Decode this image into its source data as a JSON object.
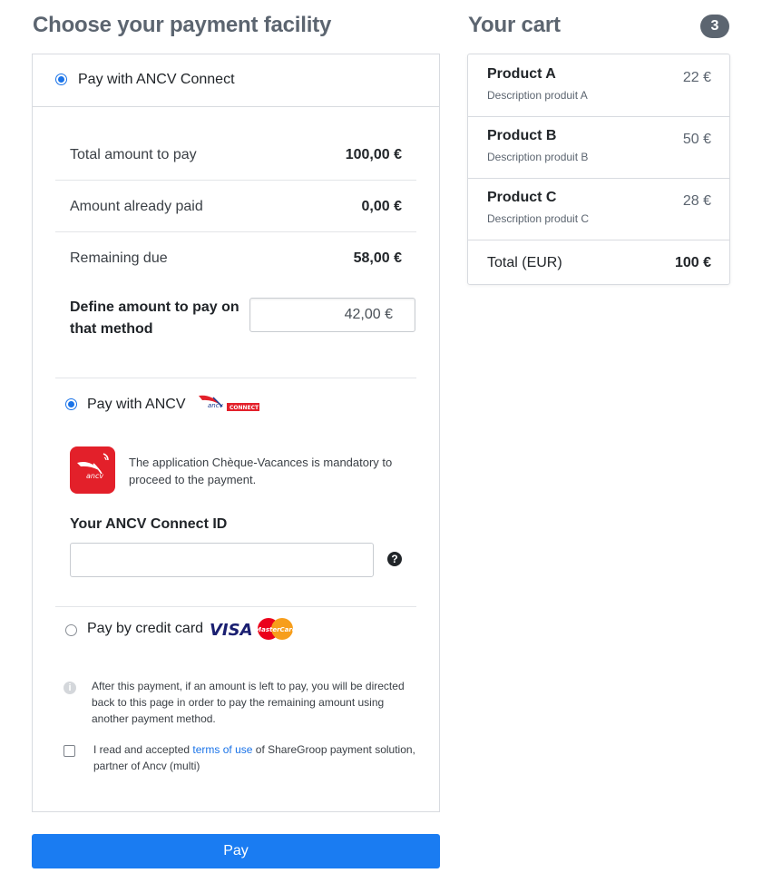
{
  "page": {
    "title": "Choose your payment facility",
    "pay_button": "Pay"
  },
  "ancv_connect": {
    "label": "Pay with ANCV Connect",
    "selected": true,
    "rows": [
      {
        "label": "Total amount to pay",
        "value": "100,00 €"
      },
      {
        "label": "Amount already paid",
        "value": "0,00 €"
      },
      {
        "label": "Remaining due",
        "value": "58,00 €"
      }
    ],
    "define_label": "Define amount to pay on that method",
    "amount_value": "42,00 €"
  },
  "pay_ancv": {
    "label": "Pay with ANCV",
    "selected": true,
    "logo_text": "ancv",
    "logo_badge": "CONNECT",
    "info": "The application Chèque-Vacances is mandatory to proceed to the payment.",
    "id_label": "Your ANCV Connect ID",
    "id_value": "",
    "help_glyph": "?"
  },
  "credit_card": {
    "label": "Pay by credit card",
    "selected": false,
    "visa_text": "VISA",
    "mastercard_text": "MasterCard"
  },
  "note": {
    "text": "After this payment, if an amount is left to pay, you will be directed back to this page in order to pay the remaining amount using another payment method.",
    "icon_glyph": "i"
  },
  "terms": {
    "prefix": "I read and accepted ",
    "link": "terms of use",
    "suffix": " of ShareGroop payment solution, partner of Ancv (multi)",
    "checked": false
  },
  "cart": {
    "title": "Your cart",
    "count": "3",
    "items": [
      {
        "name": "Product A",
        "description": "Description produit A",
        "price": "22 €"
      },
      {
        "name": "Product B",
        "description": "Description produit B",
        "price": "50 €"
      },
      {
        "name": "Product C",
        "description": "Description produit C",
        "price": "28 €"
      }
    ],
    "total_label": "Total (EUR)",
    "total_value": "100 €"
  },
  "colors": {
    "primary": "#1a7cf2",
    "heading": "#5c6570",
    "ancv_red": "#e3202a"
  }
}
